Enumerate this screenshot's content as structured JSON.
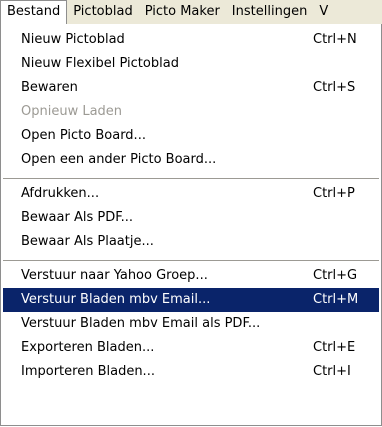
{
  "menubar": {
    "items": [
      {
        "label": "Bestand"
      },
      {
        "label": "Pictoblad"
      },
      {
        "label": "Picto Maker"
      },
      {
        "label": "Instellingen"
      },
      {
        "label": "V"
      }
    ]
  },
  "menu": {
    "groups": [
      {
        "items": [
          {
            "label": "Nieuw Pictoblad",
            "shortcut": "Ctrl+N"
          },
          {
            "label": "Nieuw Flexibel Pictoblad"
          },
          {
            "label": "Bewaren",
            "shortcut": "Ctrl+S"
          },
          {
            "label": "Opnieuw Laden",
            "disabled": true
          },
          {
            "label": "Open Picto Board..."
          },
          {
            "label": "Open een ander Picto Board..."
          }
        ]
      },
      {
        "items": [
          {
            "label": "Afdrukken...",
            "shortcut": "Ctrl+P"
          },
          {
            "label": "Bewaar Als PDF..."
          },
          {
            "label": "Bewaar Als Plaatje..."
          }
        ]
      },
      {
        "items": [
          {
            "label": "Verstuur naar Yahoo Groep...",
            "shortcut": "Ctrl+G"
          },
          {
            "label": "Verstuur Bladen mbv Email...",
            "shortcut": "Ctrl+M",
            "highlighted": true
          },
          {
            "label": "Verstuur Bladen mbv Email als PDF..."
          },
          {
            "label": "Exporteren Bladen...",
            "shortcut": "Ctrl+E"
          },
          {
            "label": "Importeren Bladen...",
            "shortcut": "Ctrl+I"
          }
        ]
      }
    ]
  },
  "colors": {
    "highlight_bg": "#0a246a",
    "highlight_text": "#ffffff",
    "disabled_text": "#9c9a94",
    "menubar_bg": "#ece9d8"
  }
}
